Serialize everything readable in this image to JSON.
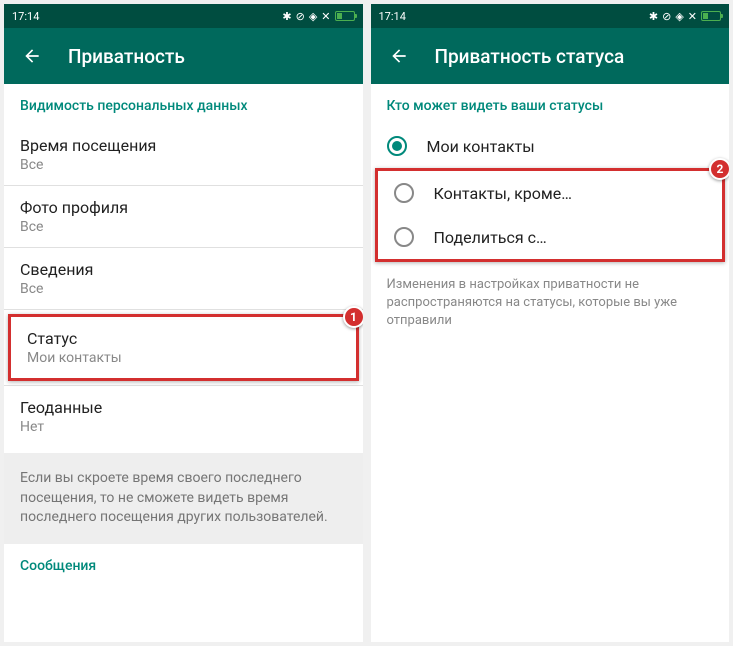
{
  "statusbar": {
    "time": "17:14",
    "icons": [
      "✱",
      "⊘",
      "◈",
      "✕"
    ]
  },
  "left": {
    "title": "Приватность",
    "section_header": "Видимость персональных данных",
    "items": [
      {
        "label": "Время посещения",
        "sub": "Все"
      },
      {
        "label": "Фото профиля",
        "sub": "Все"
      },
      {
        "label": "Сведения",
        "sub": "Все"
      },
      {
        "label": "Статус",
        "sub": "Мои контакты"
      },
      {
        "label": "Геоданные",
        "sub": "Нет"
      }
    ],
    "info": "Если вы скроете время своего последнего посещения, то не сможете видеть время последнего посещения других пользователей.",
    "bottom_link": "Сообщения",
    "badge": "1"
  },
  "right": {
    "title": "Приватность статуса",
    "section_header": "Кто может видеть ваши статусы",
    "options": [
      {
        "label": "Мои контакты",
        "checked": true
      },
      {
        "label": "Контакты, кроме…",
        "checked": false
      },
      {
        "label": "Поделиться с…",
        "checked": false
      }
    ],
    "disclaimer": "Изменения в настройках приватности не распространяются на статусы, которые вы уже отправили",
    "badge": "2"
  }
}
